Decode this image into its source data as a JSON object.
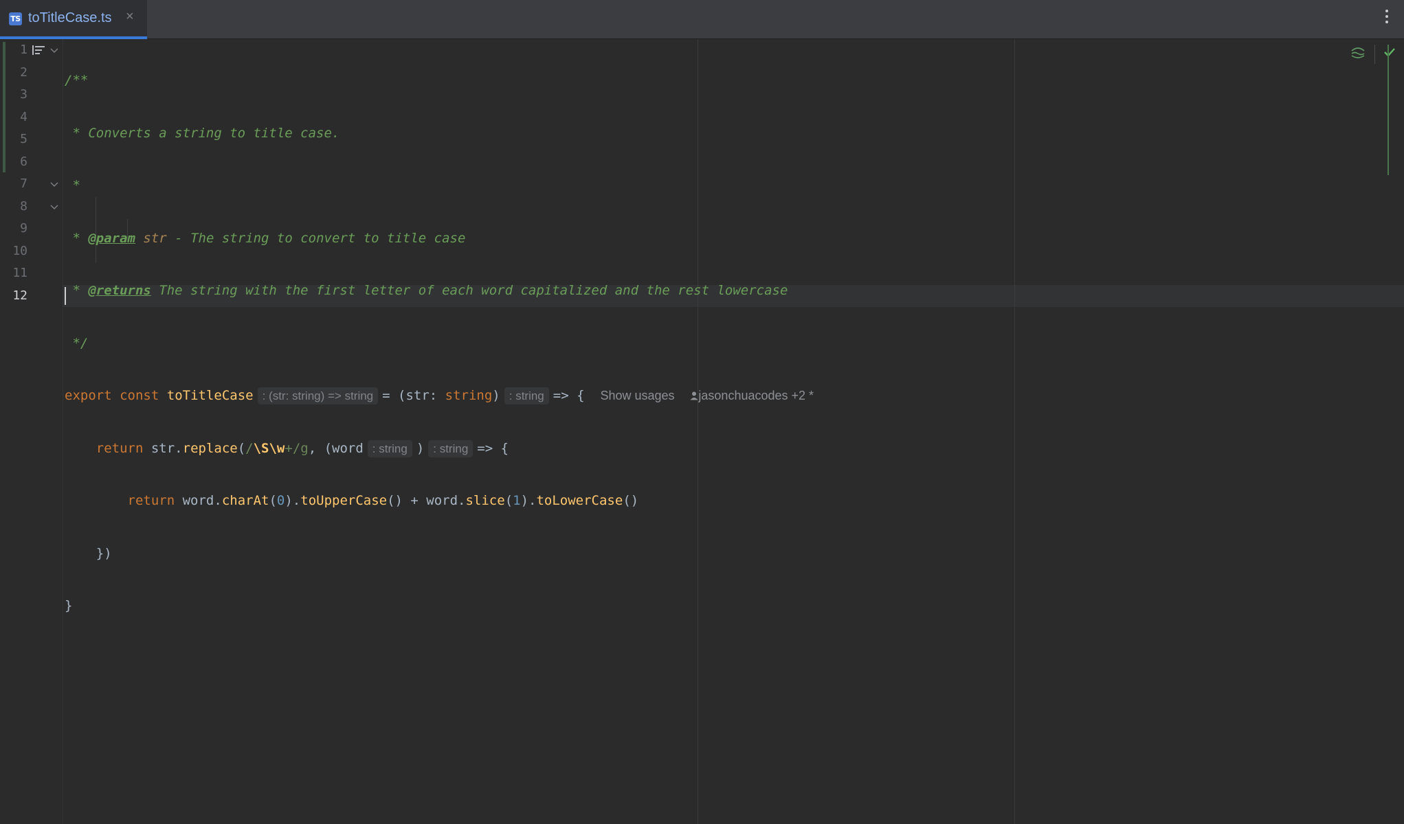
{
  "tab": {
    "title": "toTitleCase.ts",
    "icon_label": "TS",
    "close_glyph": "×"
  },
  "gutter": {
    "lines": [
      "1",
      "2",
      "3",
      "4",
      "5",
      "6",
      "7",
      "8",
      "9",
      "10",
      "11",
      "12"
    ]
  },
  "code": {
    "l1": "/**",
    "l2": " * Converts a string to title case.",
    "l3": " *",
    "l4_star": " * ",
    "l4_tag": "@param",
    "l4_name": "str",
    "l4_rest": " - The string to convert to title case",
    "l5_star": " * ",
    "l5_tag": "@returns",
    "l5_rest": " The string with the first letter of each word capitalized and the rest lowercase",
    "l6": " */",
    "l7_export": "export",
    "l7_const": "const",
    "l7_fn": "toTitleCase",
    "l7_hint1": ": (str: string) => string",
    "l7_eq": "= (str: ",
    "l7_type": "string",
    "l7_close": ")",
    "l7_hint2": ": string",
    "l7_arrow": "=> {",
    "l8_return": "return",
    "l8_str": "str.",
    "l8_replace": "replace",
    "l8_paren": "(",
    "l8_rx1": "/",
    "l8_rxbody": "\\S\\w",
    "l8_rx2": "+/g",
    "l8_comma": ", (word",
    "l8_hint1": ": string",
    "l8_close": ")",
    "l8_hint2": ": string",
    "l8_arrow": "=> {",
    "l9_return": "return",
    "l9_word": "word.",
    "l9_charat": "charAt",
    "l9_p1": "(",
    "l9_zero": "0",
    "l9_p2": ").",
    "l9_upper": "toUpperCase",
    "l9_p3": "() + word.",
    "l9_slice": "slice",
    "l9_p4": "(",
    "l9_one": "1",
    "l9_p5": ").",
    "l9_lower": "toLowerCase",
    "l9_p6": "()",
    "l10": "})",
    "l11": "}"
  },
  "lens": {
    "usages": "Show usages",
    "author": "jasonchuacodes +2 *"
  }
}
